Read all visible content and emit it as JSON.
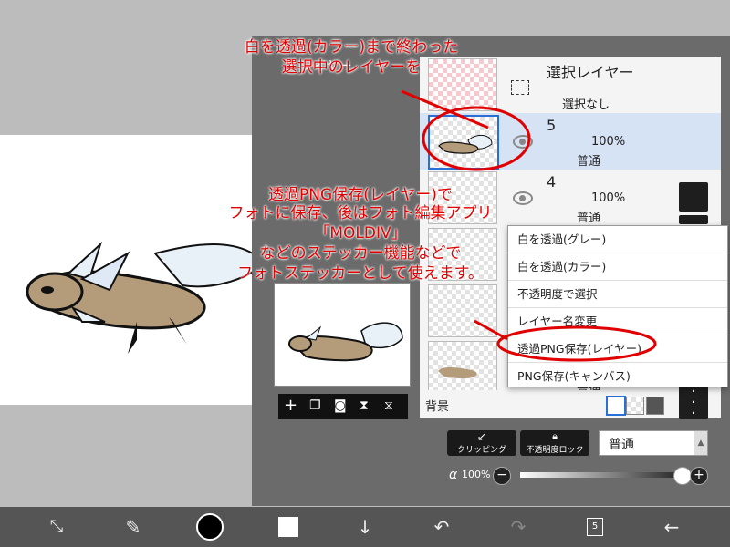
{
  "annotations": {
    "top_line1": "白を透過(カラー)まで終わった",
    "top_line2": "選択中のレイヤーを",
    "mid_line1": "透過PNG保存(レイヤー)で",
    "mid_line2": "フォトに保存、後はフォト編集アプリ",
    "mid_line3": "「MOLDIV」",
    "mid_line4": "などのステッカー機能などで",
    "mid_line5": "フォトステッカーとして使えます。"
  },
  "panel": {
    "partial_label": "レイヤー"
  },
  "selection_layer": {
    "title": "選択レイヤー",
    "status": "選択なし"
  },
  "layers": [
    {
      "number": "5",
      "opacity": "100%",
      "mode": "普通"
    },
    {
      "number": "4",
      "opacity": "100%",
      "mode": "普通"
    },
    {
      "number": "",
      "opacity": "",
      "mode": ""
    },
    {
      "number": "",
      "opacity": "",
      "mode": ""
    },
    {
      "number": "",
      "opacity": "",
      "mode": "普通"
    }
  ],
  "background_label": "背景",
  "context_menu": [
    "白を透過(グレー)",
    "白を透過(カラー)",
    "不透明度で選択",
    "レイヤー名変更",
    "透過PNG保存(レイヤー)",
    "PNG保存(キャンバス)"
  ],
  "clipping_label": "クリッピング",
  "opacity_lock_label": "不透明度ロック",
  "blend_mode": "普通",
  "alpha": {
    "symbol": "α",
    "value": "100%"
  },
  "opacity_slider": 1.0,
  "layer_count_badge": "5",
  "colors": {
    "annotation_red": "#e00000",
    "selected_row": "#d6e3f5",
    "selected_border": "#2a6fd6"
  }
}
